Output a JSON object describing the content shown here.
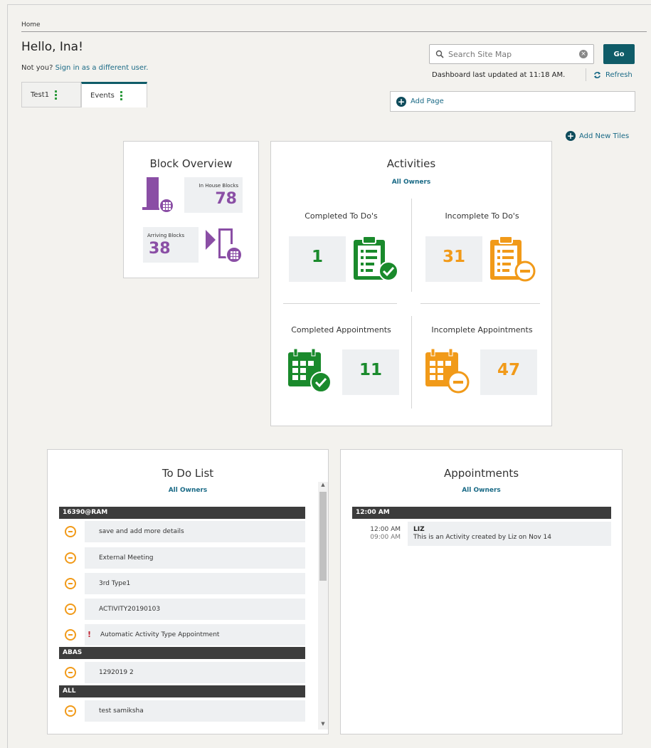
{
  "breadcrumb": "Home",
  "greeting": "Hello, Ina!",
  "not_you": {
    "prefix": "Not you?",
    "link": "Sign in as a different user."
  },
  "tabs": [
    {
      "label": "Test1",
      "active": false
    },
    {
      "label": "Events",
      "active": true
    }
  ],
  "search": {
    "placeholder": "Search Site Map",
    "go_label": "Go"
  },
  "dashboard_updated": "Dashboard last updated at 11:18 AM.",
  "refresh_label": "Refresh",
  "add_page_label": "Add Page",
  "add_new_tiles_label": "Add New Tiles",
  "block_overview": {
    "title": "Block Overview",
    "in_house_label": "In House Blocks",
    "in_house_value": "78",
    "arriving_label": "Arriving Blocks",
    "arriving_value": "38"
  },
  "activities": {
    "title": "Activities",
    "owner": "All Owners",
    "completed_todos_label": "Completed To Do's",
    "completed_todos_value": "1",
    "incomplete_todos_label": "Incomplete To Do's",
    "incomplete_todos_value": "31",
    "completed_appts_label": "Completed Appointments",
    "completed_appts_value": "11",
    "incomplete_appts_label": "Incomplete Appointments",
    "incomplete_appts_value": "47"
  },
  "todo_list": {
    "title": "To Do List",
    "owner": "All Owners",
    "groups": [
      {
        "name": "16390@RAM",
        "items": [
          "save and add more details",
          "External Meeting",
          "3rd Type1",
          "ACTIVITY20190103",
          "Automatic Activity Type Appointment"
        ]
      },
      {
        "name": "ABAS",
        "items": [
          "1292019 2"
        ]
      },
      {
        "name": "ALL",
        "items": [
          "test samiksha"
        ]
      }
    ]
  },
  "appointments": {
    "title": "Appointments",
    "owner": "All Owners",
    "group": "12:00 AM",
    "entry": {
      "start": "12:00 AM",
      "end": "09:00 AM",
      "owner": "LIZ",
      "text": "This is an Activity created by Liz on Nov 14"
    }
  },
  "colors": {
    "teal": "#0f5c68",
    "green": "#1a8a2c",
    "orange": "#f19a19",
    "purple": "#8a4ea5"
  }
}
